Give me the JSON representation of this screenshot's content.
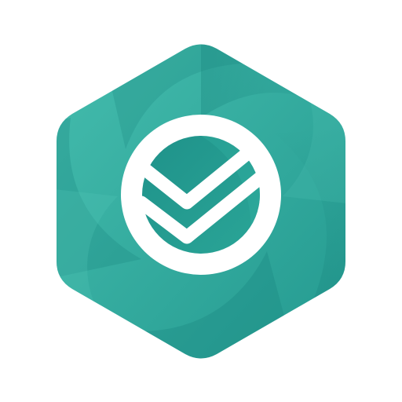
{
  "app_icon": {
    "name": "checkmark-shield-logo",
    "colors": {
      "background": "#ffffff",
      "teal_light": "#3fb8a9",
      "teal_mid": "#2ea598",
      "teal_dark": "#1d8e86",
      "mark": "#ffffff"
    }
  }
}
